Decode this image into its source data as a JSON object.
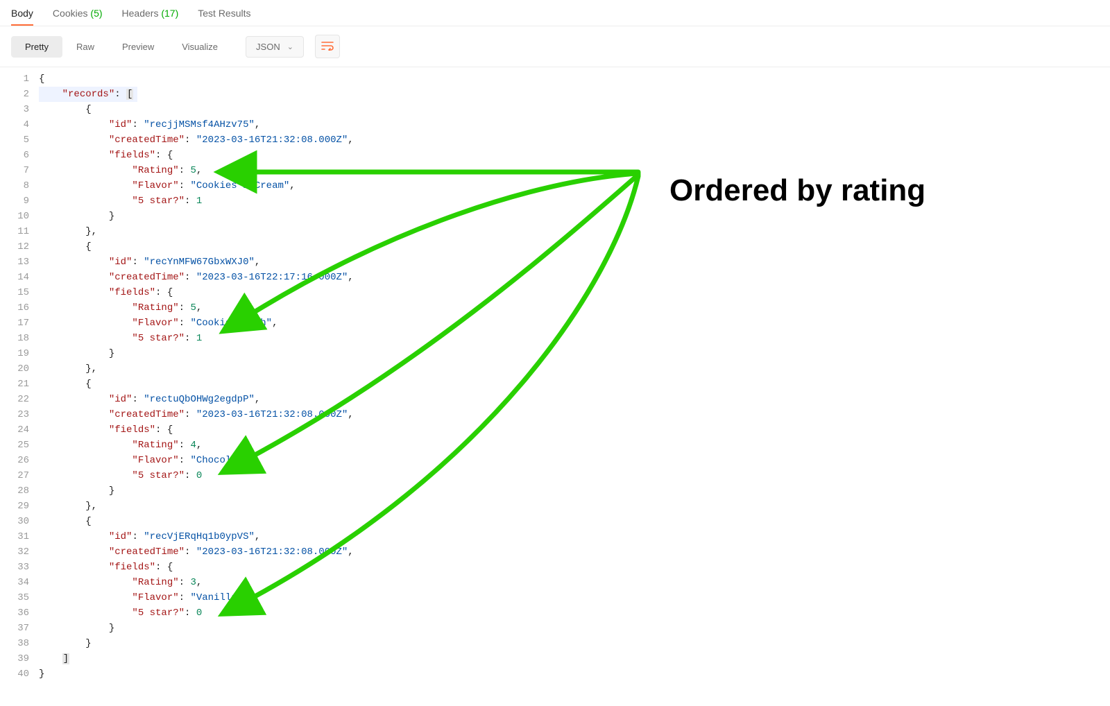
{
  "tabs": {
    "body": "Body",
    "cookies": "Cookies",
    "cookies_count": "(5)",
    "headers": "Headers",
    "headers_count": "(17)",
    "test_results": "Test Results"
  },
  "view": {
    "pretty": "Pretty",
    "raw": "Raw",
    "preview": "Preview",
    "visualize": "Visualize"
  },
  "format_select": "JSON",
  "annotation": "Ordered by rating",
  "json": {
    "root_key": "records",
    "records": [
      {
        "id": "recjjMSMsf4AHzv75",
        "createdTime": "2023-03-16T21:32:08.000Z",
        "fields": {
          "Rating": 5,
          "Flavor": "Cookies & Cream",
          "5 star?": 1
        }
      },
      {
        "id": "recYnMFW67GbxWXJ0",
        "createdTime": "2023-03-16T22:17:16.000Z",
        "fields": {
          "Rating": 5,
          "Flavor": "Cookie Dough",
          "5 star?": 1
        }
      },
      {
        "id": "rectuQbOHWg2egdpP",
        "createdTime": "2023-03-16T21:32:08.000Z",
        "fields": {
          "Rating": 4,
          "Flavor": "Chocolate",
          "5 star?": 0
        }
      },
      {
        "id": "recVjERqHq1b0ypVS",
        "createdTime": "2023-03-16T21:32:08.000Z",
        "fields": {
          "Rating": 3,
          "Flavor": "Vanilla",
          "5 star?": 0
        }
      }
    ]
  },
  "line_count": 40
}
